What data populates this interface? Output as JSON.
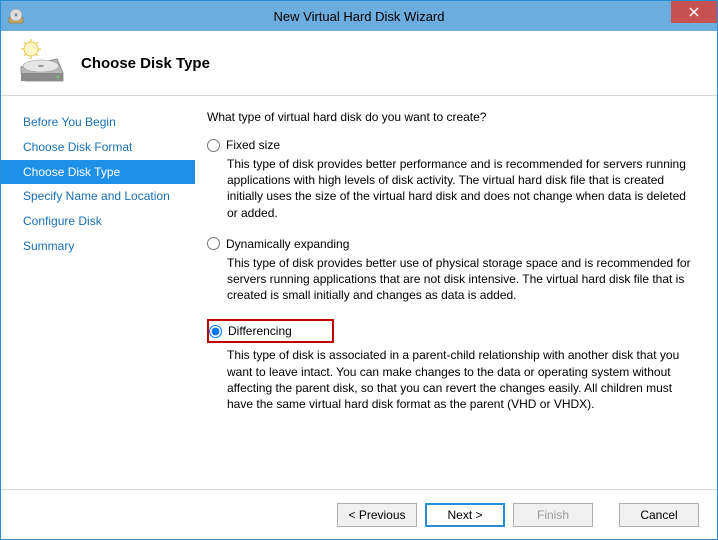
{
  "window": {
    "title": "New Virtual Hard Disk Wizard"
  },
  "header": {
    "title": "Choose Disk Type"
  },
  "sidebar": {
    "steps": [
      {
        "label": "Before You Begin",
        "current": false
      },
      {
        "label": "Choose Disk Format",
        "current": false
      },
      {
        "label": "Choose Disk Type",
        "current": true
      },
      {
        "label": "Specify Name and Location",
        "current": false
      },
      {
        "label": "Configure Disk",
        "current": false
      },
      {
        "label": "Summary",
        "current": false
      }
    ]
  },
  "main": {
    "prompt": "What type of virtual hard disk do you want to create?",
    "options": [
      {
        "id": "fixed",
        "label": "Fixed size",
        "selected": false,
        "highlighted": false,
        "description": "This type of disk provides better performance and is recommended for servers running applications with high levels of disk activity. The virtual hard disk file that is created initially uses the size of the virtual hard disk and does not change when data is deleted or added."
      },
      {
        "id": "dynamic",
        "label": "Dynamically expanding",
        "selected": false,
        "highlighted": false,
        "description": "This type of disk provides better use of physical storage space and is recommended for servers running applications that are not disk intensive. The virtual hard disk file that is created is small initially and changes as data is added."
      },
      {
        "id": "differencing",
        "label": "Differencing",
        "selected": true,
        "highlighted": true,
        "description": "This type of disk is associated in a parent-child relationship with another disk that you want to leave intact. You can make changes to the data or operating system without affecting the parent disk, so that you can revert the changes easily. All children must have the same virtual hard disk format as the parent (VHD or VHDX)."
      }
    ]
  },
  "footer": {
    "previous": "< Previous",
    "next": "Next >",
    "finish": "Finish",
    "cancel": "Cancel"
  }
}
